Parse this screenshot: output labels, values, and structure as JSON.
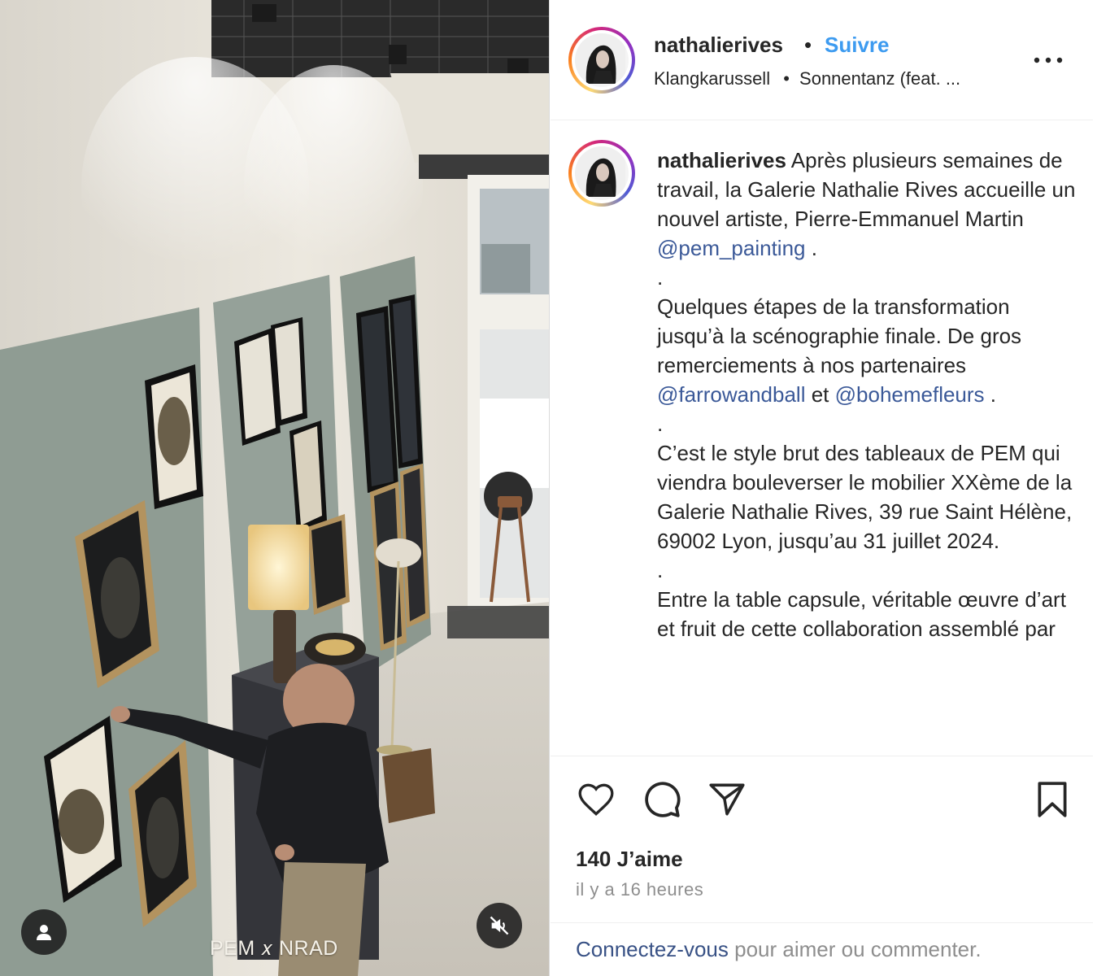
{
  "media": {
    "overlay_text": "PEM 𝑥 NRAD",
    "user_icon": "user-silhouette-icon",
    "mute_icon": "speaker-muted-icon"
  },
  "header": {
    "username": "nathalierives",
    "separator": "•",
    "follow_label": "Suivre",
    "audio_artist": "Klangkarussell",
    "audio_separator": "•",
    "audio_track": "Sonnentanz (feat. ...",
    "more_icon": "more-options-icon"
  },
  "caption": {
    "username": "nathalierives",
    "part1": " Après plusieurs semaines de travail, la Galerie Nathalie Rives accueille un nouvel artiste, Pierre-Emmanuel Martin ",
    "mention1": "@pem_painting",
    "part1_end": " .",
    "dot1": ".",
    "part2": "Quelques étapes de la transformation jusqu’à la scénographie finale. De gros remerciements à nos partenaires ",
    "mention2": "@farrowandball",
    "part2_mid": " et ",
    "mention3": "@bohemefleurs",
    "part2_end": " .",
    "dot2": ".",
    "part3": "C’est le style brut des tableaux de PEM qui viendra bouleverser le mobilier XXème de la Galerie Nathalie Rives, 39 rue Saint Hélène, 69002 Lyon, jusqu’au 31 juillet 2024.",
    "dot3": ".",
    "part4": "Entre la table capsule, véritable œuvre d’art et fruit de cette collaboration assemblé par"
  },
  "actions": {
    "like_icon": "heart-icon",
    "comment_icon": "comment-bubble-icon",
    "share_icon": "paper-plane-icon",
    "save_icon": "bookmark-icon",
    "likes_text": "140 J’aime",
    "time_text": "il y a 16 heures"
  },
  "footer": {
    "login_link": "Connectez-vous",
    "login_rest": " pour aimer ou commenter."
  },
  "colors": {
    "follow_blue": "#3d9bf0",
    "mention_blue": "#3b5998",
    "muted_gray": "#8e8e8e",
    "text": "#262626"
  }
}
